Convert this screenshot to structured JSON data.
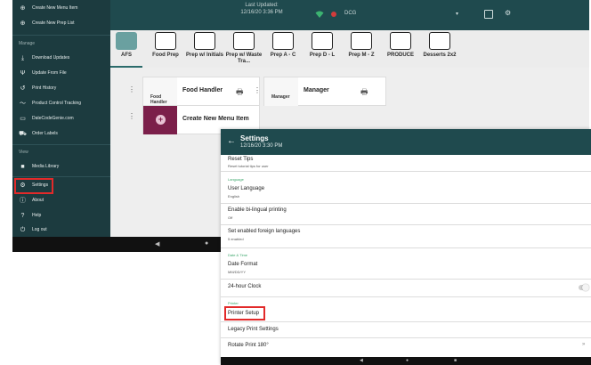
{
  "main_app": {
    "last_updated_label": "Last Updated:",
    "last_updated_value": "12/16/20 3:36 PM",
    "user_initials": "DCG",
    "categories": [
      {
        "label": "AFS"
      },
      {
        "label": "Food Prep"
      },
      {
        "label": "Prep w/ Initials"
      },
      {
        "label": "Prep w/ Waste Tra..."
      },
      {
        "label": "Prep A - C"
      },
      {
        "label": "Prep D - L"
      },
      {
        "label": "Prep M - Z"
      },
      {
        "label": "PRODUCE"
      },
      {
        "label": "Desserts 2x2"
      }
    ],
    "cards": {
      "food_handler_thumb": "Food Handler",
      "food_handler": "Food Handler",
      "manager_thumb": "Manager",
      "manager": "Manager",
      "create_new_item": "Create New Menu Item"
    }
  },
  "drawer": {
    "top_items": [
      {
        "label": "Create New Menu Item",
        "icon": "plus-circle-icon"
      },
      {
        "label": "Create New Prep List",
        "icon": "plus-circle-icon"
      }
    ],
    "manage_header": "Manage",
    "manage_items": [
      {
        "label": "Download Updates",
        "icon": "download-icon"
      },
      {
        "label": "Update From File",
        "icon": "usb-icon"
      },
      {
        "label": "Print History",
        "icon": "history-icon"
      },
      {
        "label": "Product Control Tracking",
        "icon": "trend-icon"
      },
      {
        "label": "DateCodeGenie.com",
        "icon": "monitor-icon"
      },
      {
        "label": "Order Labels",
        "icon": "cart-icon"
      }
    ],
    "view_header": "View",
    "view_items": [
      {
        "label": "Media Library",
        "icon": "folder-icon"
      }
    ],
    "bottom_items": [
      {
        "label": "Settings",
        "icon": "gear-icon"
      },
      {
        "label": "About",
        "icon": "info-icon"
      },
      {
        "label": "Help",
        "icon": "help-icon"
      },
      {
        "label": "Log out",
        "icon": "power-icon"
      }
    ]
  },
  "settings_screen": {
    "title": "Settings",
    "datetime": "12/16/20   3:30 PM",
    "reset_tips_title": "Reset Tips",
    "reset_tips_sub": "Reset tutorial tips for user",
    "language_header": "Language",
    "user_language_title": "User Language",
    "user_language_value": "English",
    "bilingual_title": "Enable bi-lingual printing",
    "bilingual_value": "Off",
    "foreign_title": "Set enabled foreign languages",
    "foreign_value": "5 enabled",
    "datetime_header": "Date & Time",
    "date_format_title": "Date Format",
    "date_format_value": "MM/DD/YY",
    "clock24_title": "24-hour Clock",
    "printer_header": "Printer",
    "printer_setup_title": "Printer Setup",
    "legacy_title": "Legacy Print Settings",
    "rotate_title": "Rotate Print 180°"
  },
  "colors": {
    "header": "#1f4a4e",
    "drawer": "#1c3b3f",
    "highlight": "#e22a2a",
    "section_header": "#3aa66a"
  }
}
